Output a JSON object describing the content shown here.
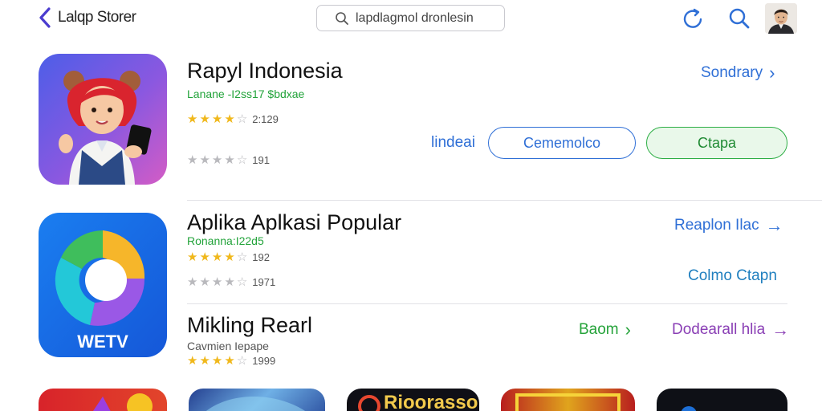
{
  "topbar": {
    "back_label": "Lalqp Storer",
    "search_placeholder": "lapdlagmol dronlesin"
  },
  "apps": [
    {
      "title": "Rapyl Indonesia",
      "subtitle": "Lanane -I2ss17 $bdxae",
      "rating1": {
        "stars": 4,
        "value": "2:129"
      },
      "rating2": {
        "stars": 4,
        "value": "191"
      },
      "link": "Sondrary",
      "label": "lindeai",
      "button_outline": "Cememolco",
      "button_green": "Ctapa"
    },
    {
      "title": "Aplika Aplkasi Popular",
      "subtitle": "Ronanna:I22d5",
      "rating1": {
        "stars": 4,
        "value": "192"
      },
      "rating2": {
        "stars": 4,
        "value": "1971"
      },
      "link": "Reaplon Ilac",
      "link2": "Colmo Ctapn",
      "icon_text": "WETV"
    },
    {
      "title": "Mikling Rearl",
      "subtitle": "Cavmien Iepape",
      "rating1": {
        "stars": 4,
        "value": "1999"
      },
      "link_green": "Baom",
      "link_purple": "Dodearall hlia"
    }
  ],
  "strip": {
    "label": "Rioorasso"
  },
  "colors": {
    "accent_blue": "#2f6fd6",
    "accent_green": "#25a33a",
    "accent_purple": "#8a3fb5",
    "star": "#f0b81c"
  }
}
